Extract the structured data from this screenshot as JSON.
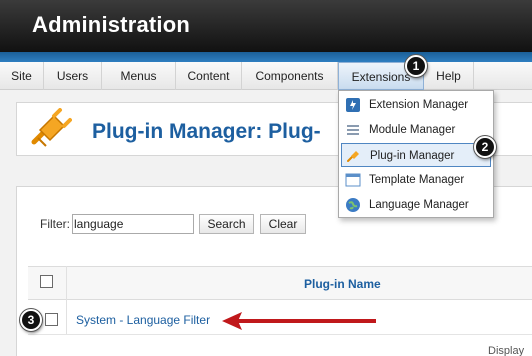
{
  "header": {
    "title": "Administration"
  },
  "menu": {
    "items": [
      {
        "label": "Site"
      },
      {
        "label": "Users"
      },
      {
        "label": "Menus"
      },
      {
        "label": "Content"
      },
      {
        "label": "Components"
      },
      {
        "label": "Extensions"
      },
      {
        "label": "Help"
      }
    ]
  },
  "page": {
    "title": "Plug-in Manager: Plug-"
  },
  "extensions_menu": {
    "items": [
      {
        "label": "Extension Manager",
        "icon": "extension-manager-icon"
      },
      {
        "label": "Module Manager",
        "icon": "module-manager-icon"
      },
      {
        "label": "Plug-in Manager",
        "icon": "plugin-icon"
      },
      {
        "label": "Template Manager",
        "icon": "template-icon"
      },
      {
        "label": "Language Manager",
        "icon": "globe-icon"
      }
    ]
  },
  "filter": {
    "label": "Filter:",
    "value": "language",
    "search_label": "Search",
    "clear_label": "Clear"
  },
  "table": {
    "columns": [
      "Plug-in Name"
    ],
    "rows": [
      {
        "name": "System - Language Filter"
      }
    ]
  },
  "footer": {
    "display_label": "Display"
  },
  "markers": [
    {
      "number": "1"
    },
    {
      "number": "2"
    },
    {
      "number": "3"
    }
  ],
  "colors": {
    "accent": "#1d5fa0",
    "header_bg": "#1f1f1f",
    "arrow": "#c0181b"
  }
}
